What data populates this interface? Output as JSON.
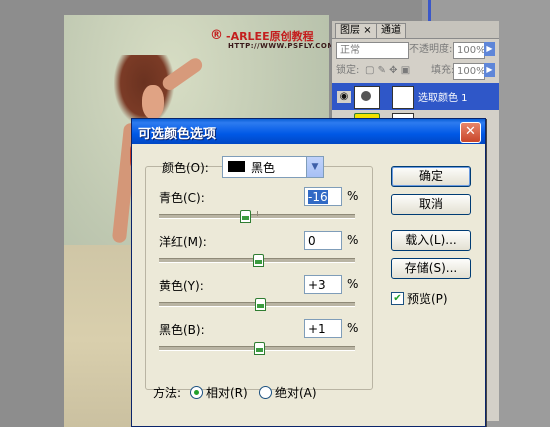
{
  "watermark": {
    "logo": "®",
    "text": "-ARLEE原创教程",
    "url": "HTTP://WWW.PSFLY.COM"
  },
  "layers_panel": {
    "tabs": [
      "图层",
      "×",
      "通道"
    ],
    "blend_mode": "正常",
    "opacity_label": "不透明度:",
    "opacity_value": "100%",
    "lock_label": "锁定:",
    "fill_label": "填充:",
    "fill_value": "100%",
    "layer_name": "选取颜色 1"
  },
  "dialog": {
    "title": "可选颜色选项",
    "colors_label": "颜色(O):",
    "colors_value": "黑色",
    "sliders": [
      {
        "label": "青色(C):",
        "value": "-16",
        "level": -16
      },
      {
        "label": "洋红(M):",
        "value": "0",
        "level": 0
      },
      {
        "label": "黄色(Y):",
        "value": "+3",
        "level": 3
      },
      {
        "label": "黑色(B):",
        "value": "+1",
        "level": 1
      }
    ],
    "percent": "%",
    "buttons": {
      "ok": "确定",
      "cancel": "取消",
      "load": "载入(L)...",
      "save": "存储(S)..."
    },
    "preview_label": "预览(P)",
    "preview_checked": true,
    "method_label": "方法:",
    "relative_label": "相对(R)",
    "absolute_label": "绝对(A)",
    "method_selected": "relative"
  },
  "colors": {
    "titlebar": "#0058e6",
    "selection": "#316ac5",
    "accent_green": "#22a02a"
  }
}
